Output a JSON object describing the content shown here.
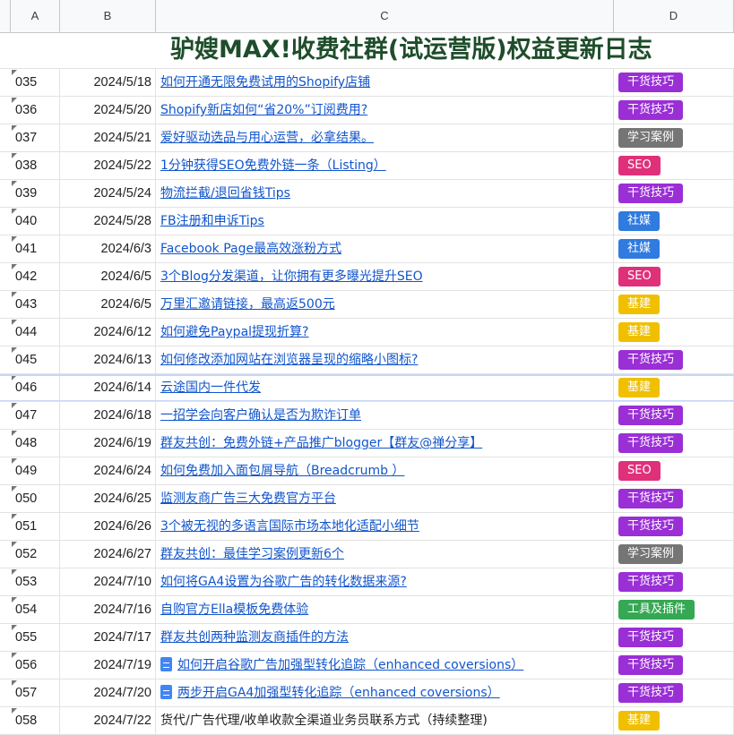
{
  "columns": [
    "A",
    "B",
    "C",
    "D"
  ],
  "title": "驴嫂MAX!收费社群(试运营版)权益更新日志",
  "tag_colors": {
    "干货技巧": "#9a2fd6",
    "学习案例": "#757575",
    "SEO": "#e0307a",
    "社媒": "#2f7be0",
    "基建": "#f0c000",
    "工具及插件": "#35a853"
  },
  "rows": [
    {
      "id": "035",
      "date": "2024/5/18",
      "text": "如何开通无限免费试用的Shopify店铺",
      "link": true,
      "doc": false,
      "tag": "干货技巧"
    },
    {
      "id": "036",
      "date": "2024/5/20",
      "text": "Shopify新店如何“省20%”订阅费用?",
      "link": true,
      "doc": false,
      "tag": "干货技巧"
    },
    {
      "id": "037",
      "date": "2024/5/21",
      "text": "爱好驱动选品与用心运营，必拿结果。",
      "link": true,
      "doc": false,
      "tag": "学习案例"
    },
    {
      "id": "038",
      "date": "2024/5/22",
      "text": "1分钟获得SEO免费外链一条（Listing）",
      "link": true,
      "doc": false,
      "tag": "SEO"
    },
    {
      "id": "039",
      "date": "2024/5/24",
      "text": "物流拦截/退回省钱Tips",
      "link": true,
      "doc": false,
      "tag": "干货技巧"
    },
    {
      "id": "040",
      "date": "2024/5/28",
      "text": "FB注册和申诉Tips",
      "link": true,
      "doc": false,
      "tag": "社媒"
    },
    {
      "id": "041",
      "date": "2024/6/3",
      "text": "Facebook Page最高效涨粉方式",
      "link": true,
      "doc": false,
      "tag": "社媒"
    },
    {
      "id": "042",
      "date": "2024/6/5",
      "text": "3个Blog分发渠道，让你拥有更多曝光提升SEO",
      "link": true,
      "doc": false,
      "tag": "SEO"
    },
    {
      "id": "043",
      "date": "2024/6/5",
      "text": "万里汇邀请链接，最高返500元",
      "link": true,
      "doc": false,
      "tag": "基建"
    },
    {
      "id": "044",
      "date": "2024/6/12",
      "text": "如何避免Paypal提现折算?",
      "link": true,
      "doc": false,
      "tag": "基建"
    },
    {
      "id": "045",
      "date": "2024/6/13",
      "text": "如何修改添加网站在浏览器呈现的缩略小图标?",
      "link": true,
      "doc": false,
      "tag": "干货技巧"
    },
    {
      "id": "046",
      "date": "2024/6/14",
      "text": "云途国内一件代发",
      "link": true,
      "doc": false,
      "tag": "基建"
    },
    {
      "id": "047",
      "date": "2024/6/18",
      "text": "一招学会向客户确认是否为欺诈订单",
      "link": true,
      "doc": false,
      "tag": "干货技巧"
    },
    {
      "id": "048",
      "date": "2024/6/19",
      "text": "群友共创：免费外链+产品推广blogger【群友@禅分享】",
      "link": true,
      "doc": false,
      "tag": "干货技巧"
    },
    {
      "id": "049",
      "date": "2024/6/24",
      "text": "如何免费加入面包屑导航（Breadcrumb ）",
      "link": true,
      "doc": false,
      "tag": "SEO"
    },
    {
      "id": "050",
      "date": "2024/6/25",
      "text": "监测友商广告三大免费官方平台",
      "link": true,
      "doc": false,
      "tag": "干货技巧"
    },
    {
      "id": "051",
      "date": "2024/6/26",
      "text": "3个被无视的多语言国际市场本地化适配小细节",
      "link": true,
      "doc": false,
      "tag": "干货技巧"
    },
    {
      "id": "052",
      "date": "2024/6/27",
      "text": "群友共创：最佳学习案例更新6个",
      "link": true,
      "doc": false,
      "tag": "学习案例"
    },
    {
      "id": "053",
      "date": "2024/7/10",
      "text": "如何将GA4设置为谷歌广告的转化数据来源?",
      "link": true,
      "doc": false,
      "tag": "干货技巧"
    },
    {
      "id": "054",
      "date": "2024/7/16",
      "text": "自购官方Ella模板免费体验",
      "link": true,
      "doc": false,
      "tag": "工具及插件"
    },
    {
      "id": "055",
      "date": "2024/7/17",
      "text": "群友共创两种监测友商插件的方法",
      "link": true,
      "doc": false,
      "tag": "干货技巧"
    },
    {
      "id": "056",
      "date": "2024/7/19",
      "text": "如何开启谷歌广告加强型转化追踪（enhanced coversions）",
      "link": true,
      "doc": true,
      "tag": "干货技巧"
    },
    {
      "id": "057",
      "date": "2024/7/20",
      "text": "两步开启GA4加强型转化追踪（enhanced coversions）",
      "link": true,
      "doc": true,
      "tag": "干货技巧"
    },
    {
      "id": "058",
      "date": "2024/7/22",
      "text": "货代/广告代理/收单收款全渠道业务员联系方式（持续整理)",
      "link": false,
      "doc": false,
      "tag": "基建"
    }
  ]
}
